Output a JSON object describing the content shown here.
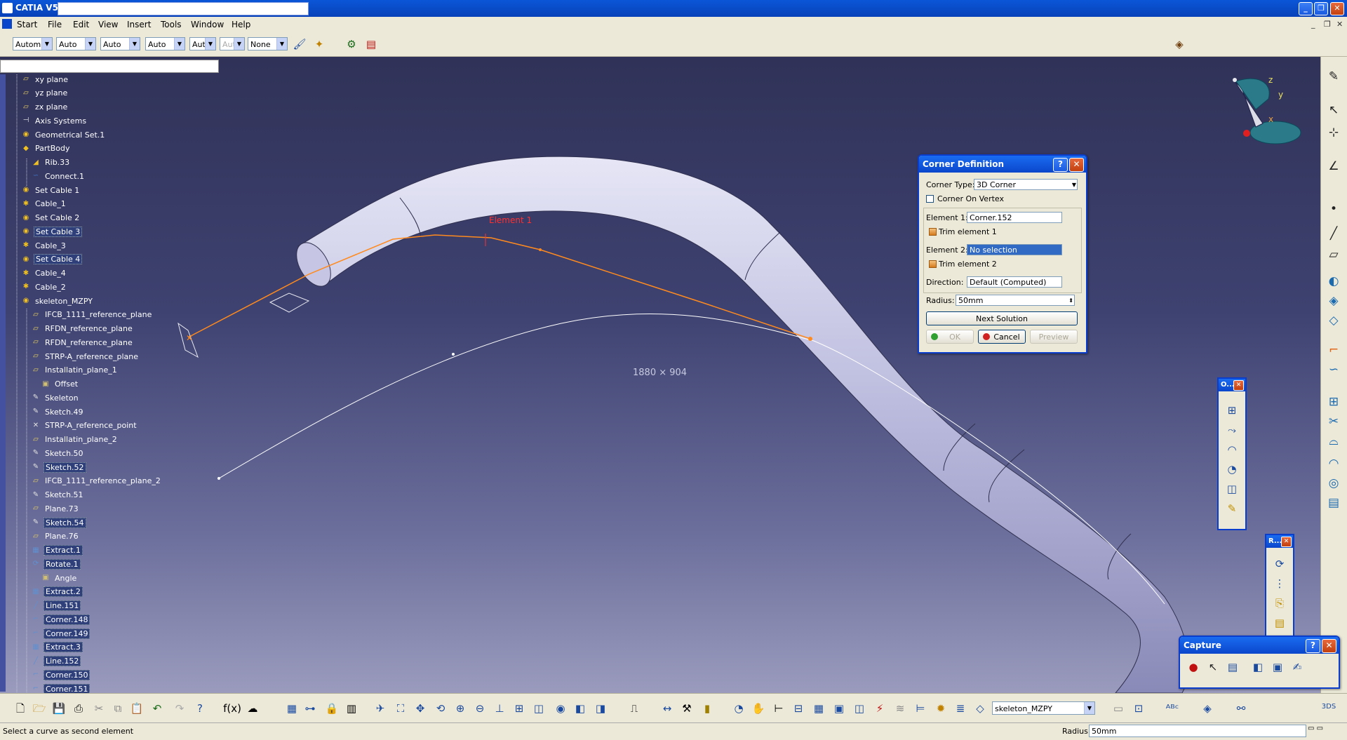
{
  "window": {
    "app_title": "CATIA V5",
    "btn_minimize": "_",
    "btn_restore": "❐",
    "btn_close": "✕"
  },
  "menu": {
    "items": [
      "Start",
      "File",
      "Edit",
      "View",
      "Insert",
      "Tools",
      "Window",
      "Help"
    ],
    "mdi_minimize": "_",
    "mdi_restore": "❐",
    "mdi_close": "✕"
  },
  "toolbar": {
    "combos": [
      "Automa",
      "Auto",
      "Auto",
      "Auto",
      "Aut",
      "Aut",
      "None"
    ]
  },
  "tree": {
    "items": [
      {
        "label": "xy plane",
        "icon": "plane-icon"
      },
      {
        "label": "yz plane",
        "icon": "plane-icon"
      },
      {
        "label": "zx plane",
        "icon": "plane-icon"
      },
      {
        "label": "Axis Systems",
        "icon": "axis-icon"
      },
      {
        "label": "Geometrical Set.1",
        "icon": "geoset-icon"
      },
      {
        "label": "PartBody",
        "icon": "body-icon"
      },
      {
        "label": "Rib.33",
        "icon": "rib-icon"
      },
      {
        "label": "Connect.1",
        "icon": "connect-icon"
      },
      {
        "label": "Set Cable 1",
        "icon": "geoset-icon"
      },
      {
        "label": "Cable_1",
        "icon": "cable-icon"
      },
      {
        "label": "Set Cable 2",
        "icon": "geoset-icon"
      },
      {
        "label": "Set Cable 3",
        "icon": "geoset-icon"
      },
      {
        "label": "Cable_3",
        "icon": "cable-icon"
      },
      {
        "label": "Set Cable 4",
        "icon": "geoset-icon"
      },
      {
        "label": "Cable_4",
        "icon": "cable-icon"
      },
      {
        "label": "Cable_2",
        "icon": "cable-icon"
      },
      {
        "label": "skeleton_MZPY",
        "icon": "geoset-icon"
      },
      {
        "label": "IFCB_1111_reference_plane",
        "icon": "plane-icon"
      },
      {
        "label": "RFDN_reference_plane",
        "icon": "plane-icon"
      },
      {
        "label": "RFDN_reference_plane",
        "icon": "plane-icon"
      },
      {
        "label": "STRP-A_reference_plane",
        "icon": "plane-icon"
      },
      {
        "label": "Installatin_plane_1",
        "icon": "plane-icon"
      },
      {
        "label": "Offset",
        "icon": "parameter-icon"
      },
      {
        "label": "Skeleton",
        "icon": "sketch-icon"
      },
      {
        "label": "Sketch.49",
        "icon": "sketch-icon"
      },
      {
        "label": "STRP-A_reference_point",
        "icon": "point-icon"
      },
      {
        "label": "Installatin_plane_2",
        "icon": "plane-icon"
      },
      {
        "label": "Sketch.50",
        "icon": "sketch-icon"
      },
      {
        "label": "Sketch.52",
        "icon": "sketch-icon"
      },
      {
        "label": "IFCB_1111_reference_plane_2",
        "icon": "plane-icon"
      },
      {
        "label": "Sketch.51",
        "icon": "sketch-icon"
      },
      {
        "label": "Plane.73",
        "icon": "plane-icon"
      },
      {
        "label": "Sketch.54",
        "icon": "sketch-icon"
      },
      {
        "label": "Plane.76",
        "icon": "plane-icon"
      },
      {
        "label": "Extract.1",
        "icon": "extract-icon"
      },
      {
        "label": "Rotate.1",
        "icon": "rotate-icon"
      },
      {
        "label": "Angle",
        "icon": "parameter-icon"
      },
      {
        "label": "Extract.2",
        "icon": "extract-icon"
      },
      {
        "label": "Line.151",
        "icon": "line-icon"
      },
      {
        "label": "Corner.148",
        "icon": "corner-icon"
      },
      {
        "label": "Corner.149",
        "icon": "corner-icon"
      },
      {
        "label": "Extract.3",
        "icon": "extract-icon"
      },
      {
        "label": "Line.152",
        "icon": "line-icon"
      },
      {
        "label": "Corner.150",
        "icon": "corner-icon"
      },
      {
        "label": "Corner.151",
        "icon": "corner-icon"
      }
    ]
  },
  "viewport": {
    "element_label": "Element 1",
    "dimension_text": "1880 × 904",
    "compass": {
      "x": "x",
      "y": "y",
      "z": "z"
    }
  },
  "corner_dialog": {
    "title": "Corner Definition",
    "help": "?",
    "close": "✕",
    "corner_type_label": "Corner Type:",
    "corner_type_value": "3D Corner",
    "corner_on_vertex_label": "Corner On Vertex",
    "element1_label": "Element 1:",
    "element1_value": "Corner.152",
    "trim1_label": "Trim element 1",
    "element2_label": "Element 2:",
    "element2_value": "No selection",
    "trim2_label": "Trim element 2",
    "direction_label": "Direction:",
    "direction_value": "Default (Computed)",
    "radius_label": "Radius:",
    "radius_value": "50mm",
    "next_solution_label": "Next Solution",
    "ok_label": "OK",
    "cancel_label": "Cancel",
    "preview_label": "Preview"
  },
  "mini_toolbar_o": {
    "title": "O...",
    "close": "✕"
  },
  "mini_toolbar_r": {
    "title": "R...",
    "close": "✕"
  },
  "capture_dialog": {
    "title": "Capture",
    "help": "?",
    "close": "✕"
  },
  "bottom": {
    "workbench_combo": "skeleton_MZPY"
  },
  "status": {
    "message": "Select a curve as second element",
    "radius_label": "Radius",
    "radius_value": "50mm"
  },
  "colors": {
    "accent_orange": "#ff8a1e",
    "selection_blue": "#316ac5",
    "title_blue": "#0a46cc"
  }
}
